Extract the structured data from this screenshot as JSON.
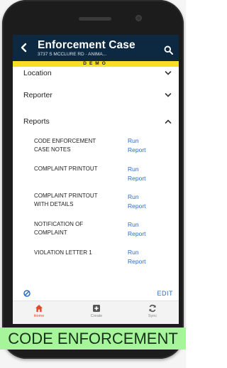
{
  "header": {
    "title": "Enforcement Case",
    "subtitle": "3737 S MCCLURE RD · ANIMA...",
    "back_icon": "chevron-left-icon",
    "search_icon": "search-icon"
  },
  "environment_badge": "DEMO",
  "sections": [
    {
      "label": "Location",
      "expanded": false
    },
    {
      "label": "Reporter",
      "expanded": false
    },
    {
      "label": "Reports",
      "expanded": true
    }
  ],
  "reports": [
    {
      "name_lines": [
        "CODE ENFORCEMENT",
        "CASE NOTES"
      ],
      "action_lines": [
        "Run",
        "Report"
      ]
    },
    {
      "name_lines": [
        "COMPLAINT PRINTOUT"
      ],
      "action_lines": [
        "Run",
        "Report"
      ]
    },
    {
      "name_lines": [
        "COMPLAINT PRINTOUT",
        "WITH DETAILS"
      ],
      "action_lines": [
        "Run",
        "Report"
      ]
    },
    {
      "name_lines": [
        "NOTIFICATION OF",
        "COMPLAINT"
      ],
      "action_lines": [
        "Run",
        "Report"
      ]
    },
    {
      "name_lines": [
        "VIOLATION LETTER 1"
      ],
      "action_lines": [
        "Run",
        "Report"
      ]
    }
  ],
  "footer": {
    "edit_label": "EDIT",
    "left_icon": "ban-icon"
  },
  "bottom_nav": [
    {
      "label": "Home",
      "icon": "home-icon",
      "active": true
    },
    {
      "label": "Create",
      "icon": "plus-square-icon",
      "active": false
    },
    {
      "label": "Sync",
      "icon": "sync-icon",
      "active": false
    }
  ],
  "banner": "CODE ENFORCEMENT",
  "colors": {
    "header_bg": "#0d2942",
    "demo_bar": "#f7df26",
    "link": "#2b6cc4",
    "nav_active": "#e8462a",
    "banner_bg": "#a6f59a"
  }
}
